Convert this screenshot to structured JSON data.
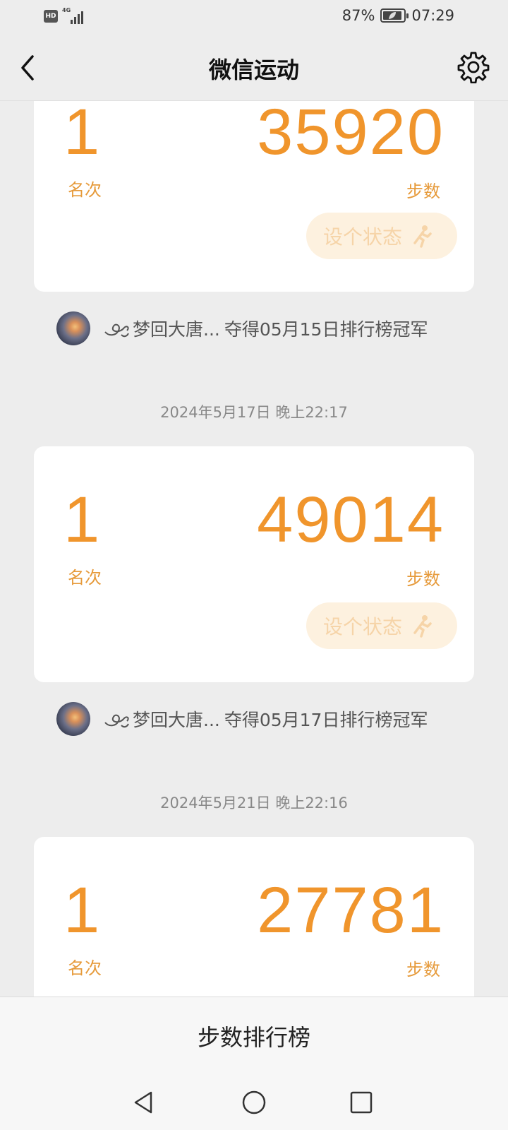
{
  "status_bar": {
    "hd_badge": "HD",
    "network": "4G",
    "battery_percent": "87%",
    "time": "07:29"
  },
  "nav": {
    "title": "微信运动",
    "back_icon": "chevron-left-icon",
    "settings_icon": "gear-icon"
  },
  "feed": {
    "items": [
      {
        "rank": "1",
        "rank_label": "名次",
        "steps": "35920",
        "steps_label": "步数",
        "status_button": "设个状态",
        "champion_prefix": "梦回大唐...",
        "champion_text": "夺得05月15日排行榜冠军"
      },
      {
        "timestamp": "2024年5月17日 晚上22:17",
        "rank": "1",
        "rank_label": "名次",
        "steps": "49014",
        "steps_label": "步数",
        "status_button": "设个状态",
        "champion_prefix": "梦回大唐...",
        "champion_text": "夺得05月17日排行榜冠军"
      },
      {
        "timestamp": "2024年5月21日 晚上22:16",
        "rank": "1",
        "rank_label": "名次",
        "steps": "27781",
        "steps_label": "步数"
      }
    ]
  },
  "bottom_tab": {
    "label": "步数排行榜"
  },
  "colors": {
    "accent": "#f0952c",
    "background": "#ededed",
    "card": "#ffffff",
    "status_button_bg": "#fdf1df"
  }
}
